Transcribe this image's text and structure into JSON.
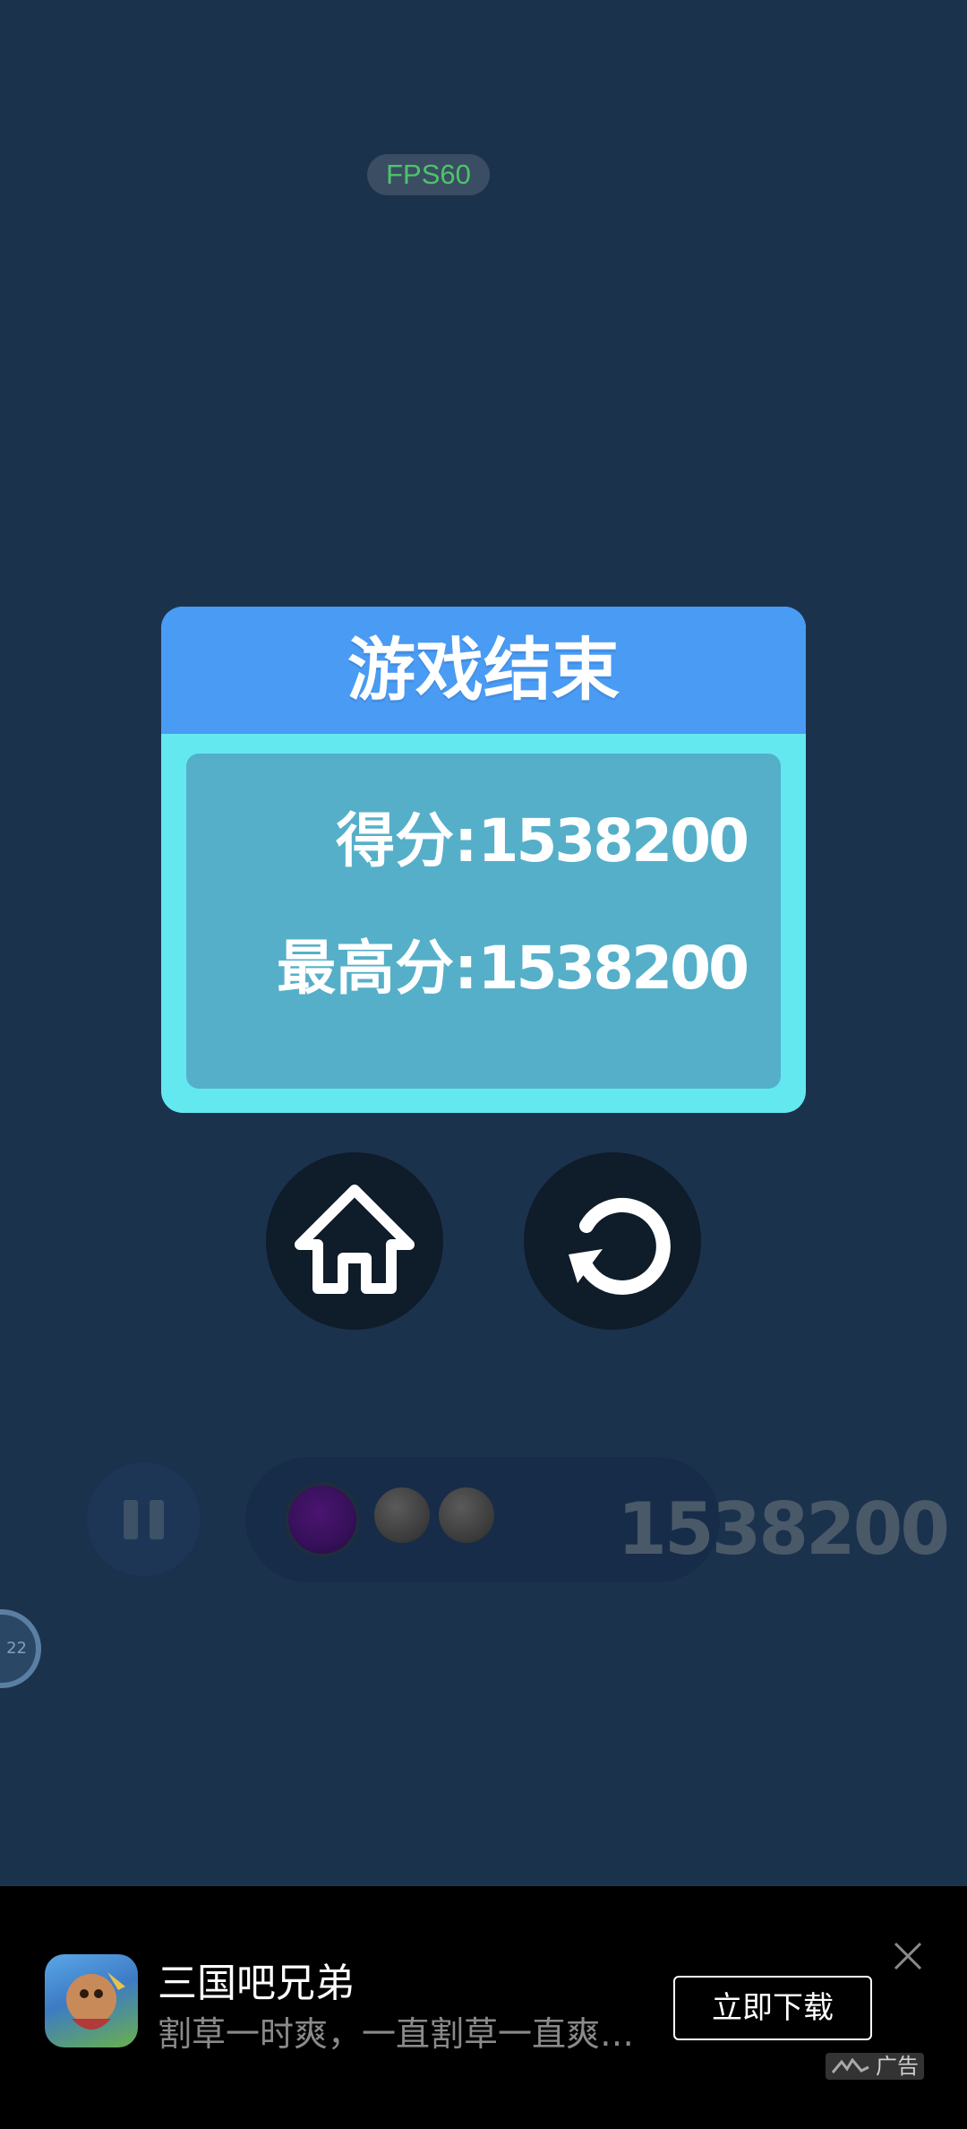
{
  "fps_label": "FPS60",
  "game_over": {
    "title": "游戏结束",
    "score_label": "得分:",
    "score_value": "1538200",
    "best_label": "最高分:",
    "best_value": "1538200"
  },
  "buttons": {
    "home_icon": "home-icon",
    "restart_icon": "restart-icon"
  },
  "hud": {
    "score": "1538200",
    "timer": "22"
  },
  "ad": {
    "title": "三国吧兄弟",
    "description": "割草一时爽，一直割草一直爽…",
    "cta": "立即下载",
    "tag": "广告"
  },
  "colors": {
    "background": "#1b324d",
    "card_header": "#4a9bf4",
    "card_border": "#64e8f0",
    "card_body": "#55afc9"
  }
}
